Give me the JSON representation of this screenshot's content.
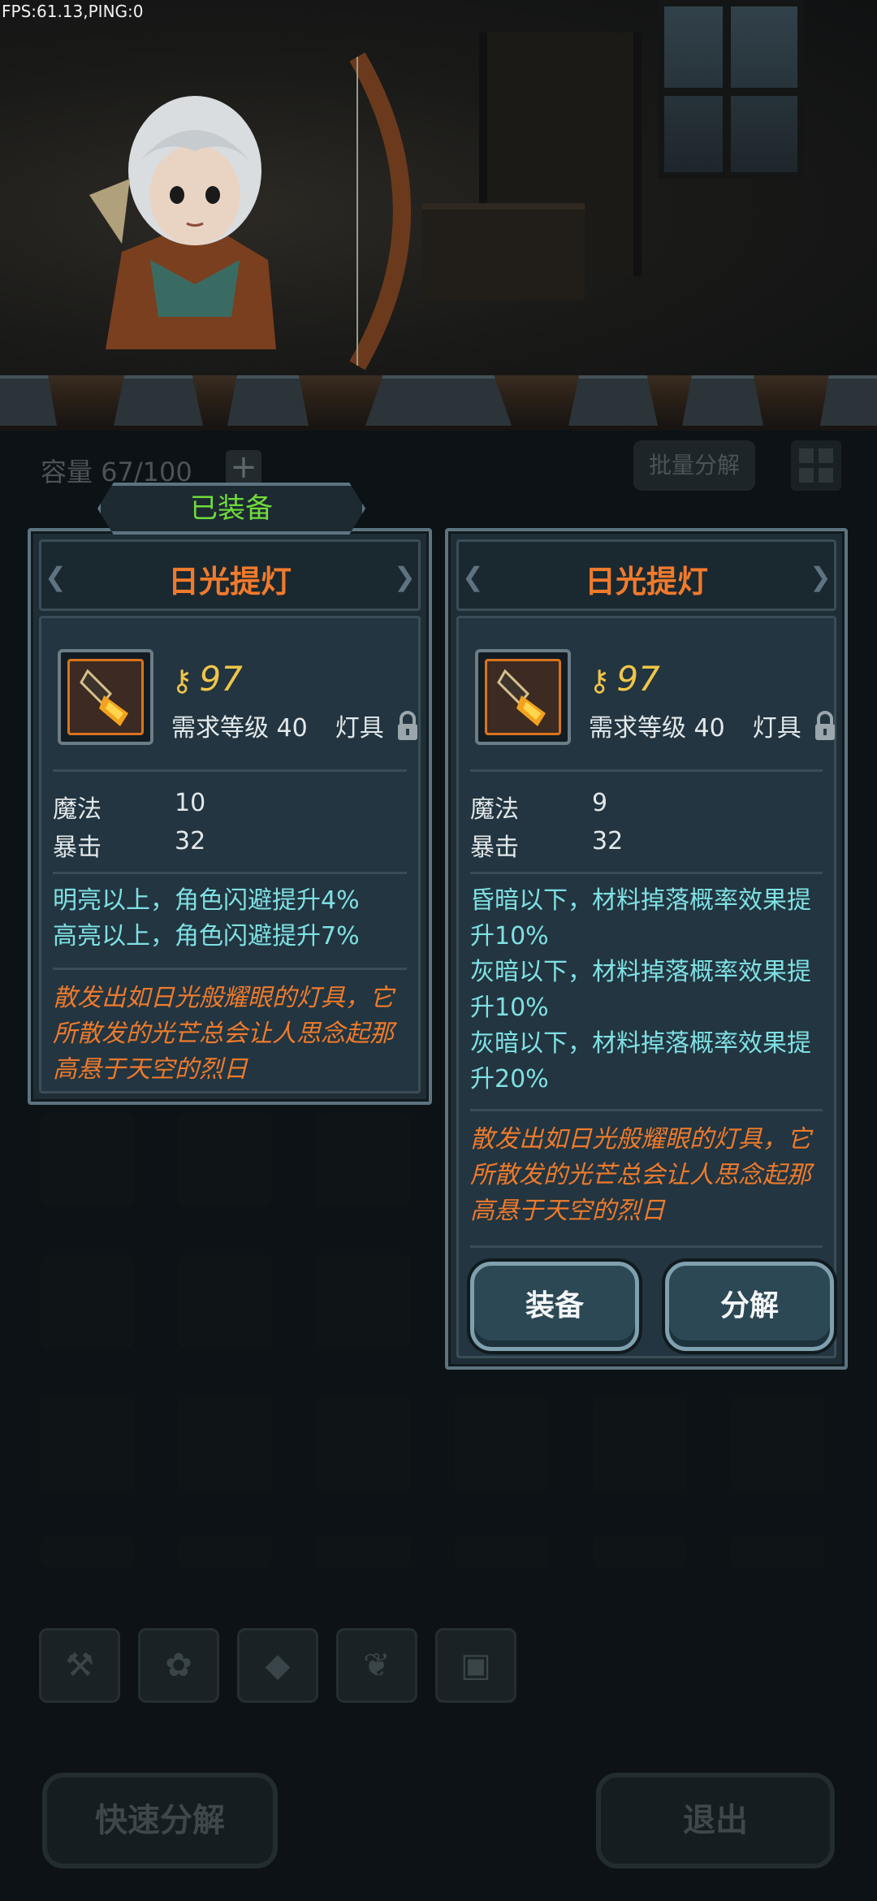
{
  "debug": {
    "fps_text": "FPS:61.13,PING:0"
  },
  "inventory": {
    "capacity_label": "容量 67/100",
    "add_capacity_icon": "plus-icon",
    "batch_decompose_label": "批量分解",
    "grid_view_icon": "grid-icon"
  },
  "equipped": {
    "tag_label": "已装备",
    "item": {
      "name": "日光提灯",
      "power": "97",
      "required_level": "需求等级 40",
      "type": "灯具",
      "stats": [
        {
          "name": "魔法",
          "value": "10"
        },
        {
          "name": "暴击",
          "value": "32"
        }
      ],
      "effects": [
        "明亮以上，角色闪避提升4%",
        "高亮以上，角色闪避提升7%"
      ],
      "flavor": "散发出如日光般耀眼的灯具，它所散发的光芒总会让人思念起那高悬于天空的烈日"
    }
  },
  "selected": {
    "item": {
      "name": "日光提灯",
      "power": "97",
      "required_level": "需求等级 40",
      "type": "灯具",
      "stats": [
        {
          "name": "魔法",
          "value": "9"
        },
        {
          "name": "暴击",
          "value": "32"
        }
      ],
      "effects": [
        "昏暗以下，材料掉落概率效果提升10%",
        "灰暗以下，材料掉落概率效果提升10%",
        "灰暗以下，材料掉落概率效果提升20%"
      ],
      "flavor": "散发出如日光般耀眼的灯具，它所散发的光芒总会让人思念起那高悬于天空的烈日"
    },
    "equip_label": "装备",
    "decompose_label": "分解"
  },
  "tabs": [
    {
      "icon": "hammer-icon"
    },
    {
      "icon": "paw-icon"
    },
    {
      "icon": "gem-icon"
    },
    {
      "icon": "leaf-icon"
    },
    {
      "icon": "chest-icon"
    }
  ],
  "footer": {
    "quick_decompose_label": "快速分解",
    "exit_label": "退出"
  },
  "colors": {
    "item_name": "#f07a2c",
    "effect_text": "#7fe0e3",
    "flavor_text": "#ee7a2c",
    "power_text": "#f0c548",
    "equipped_tag": "#6fdc3c"
  }
}
